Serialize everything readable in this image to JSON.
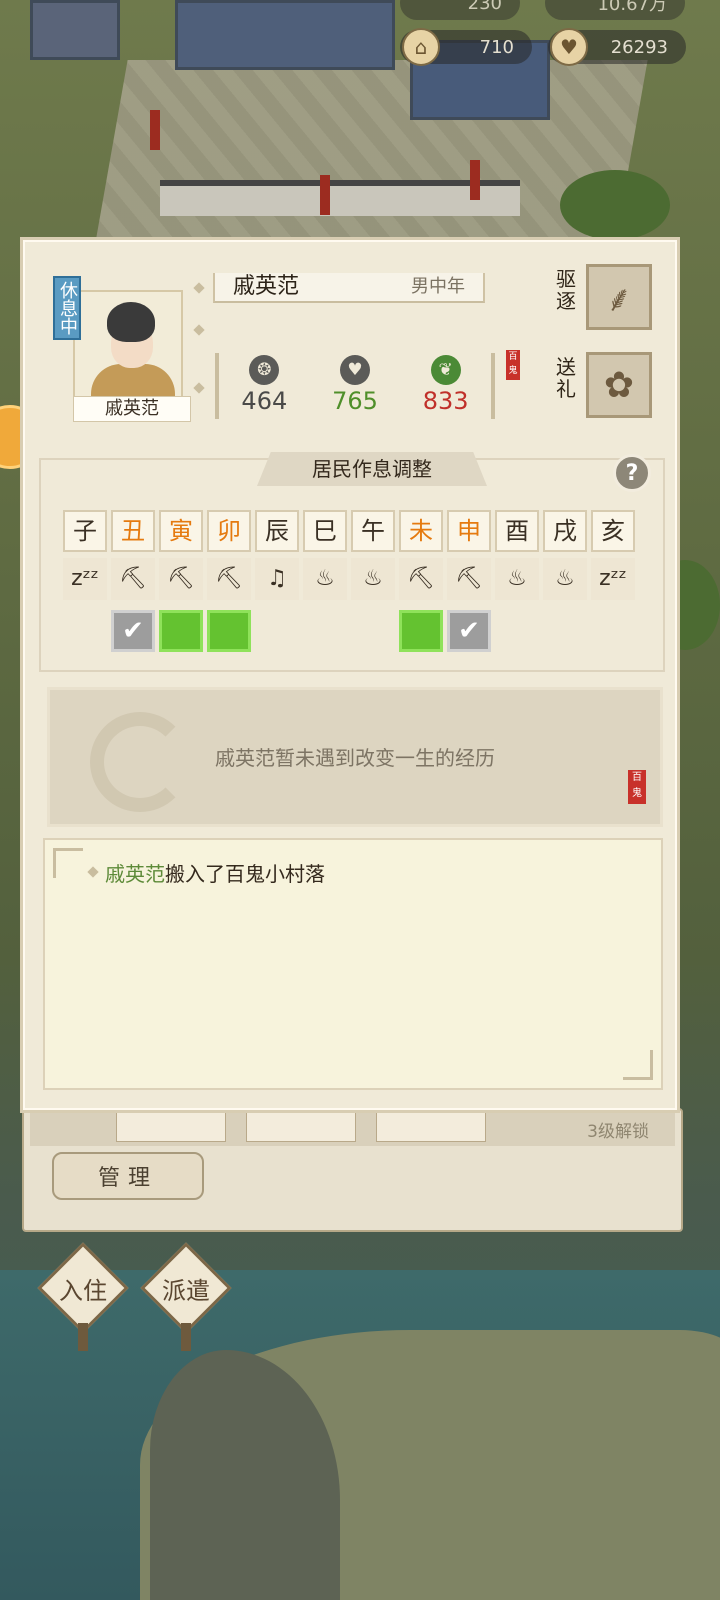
{
  "resources": {
    "top_left_value": "230",
    "top_right_value": "10.67万",
    "building_value": "710",
    "heart_value": "26293",
    "building_icon": "pavilion-icon",
    "heart_icon": "heart-icon"
  },
  "resident": {
    "status": "休息中",
    "name": "戚英范",
    "plate_name": "戚英范",
    "age_gender": "男中年",
    "seal_text": "百鬼",
    "stats": [
      {
        "icon": "spirit-icon",
        "glyph": "❂",
        "value": "464",
        "color": "#4a4a48"
      },
      {
        "icon": "heart-icon",
        "glyph": "♥",
        "value": "765",
        "color": "#4f8f2a"
      },
      {
        "icon": "leaf-icon",
        "glyph": "❦",
        "value": "833",
        "color": "#c0302a"
      }
    ]
  },
  "actions": {
    "expel_label": "驱逐",
    "gift_label": "送礼"
  },
  "schedule": {
    "title": "居民作息调整",
    "help_label": "?",
    "hours": [
      "子",
      "丑",
      "寅",
      "卯",
      "辰",
      "巳",
      "午",
      "未",
      "申",
      "酉",
      "戌",
      "亥"
    ],
    "highlight_hours": [
      1,
      2,
      3,
      7,
      8
    ],
    "activities": [
      "zᶻᶻ",
      "⛏",
      "⛏",
      "⛏",
      "♫",
      "♨",
      "♨",
      "⛏",
      "⛏",
      "♨",
      "♨",
      "zᶻᶻ"
    ],
    "activity_icons": [
      "sleep-icon",
      "pickaxe-icon",
      "pickaxe-icon",
      "pickaxe-icon",
      "music-icon",
      "meal-bowl-icon",
      "meal-bowl-icon",
      "pickaxe-icon",
      "pickaxe-icon",
      "meal-bowl-icon",
      "meal-bowl-icon",
      "sleep-icon"
    ],
    "checks": [
      "none",
      "checked",
      "selected",
      "selected",
      "none",
      "none",
      "none",
      "selected",
      "checked",
      "none",
      "none",
      "none"
    ],
    "check_glyph": "✔"
  },
  "event": {
    "text": "戚英范暂未遇到改变一生的经历",
    "seal_text": "百鬼"
  },
  "log": {
    "name": "戚英范",
    "text": "搬入了百鬼小村落"
  },
  "bottom": {
    "lock_text": "3级解锁",
    "manage_label": "管理",
    "move_in_label": "入住",
    "dispatch_label": "派遣"
  }
}
